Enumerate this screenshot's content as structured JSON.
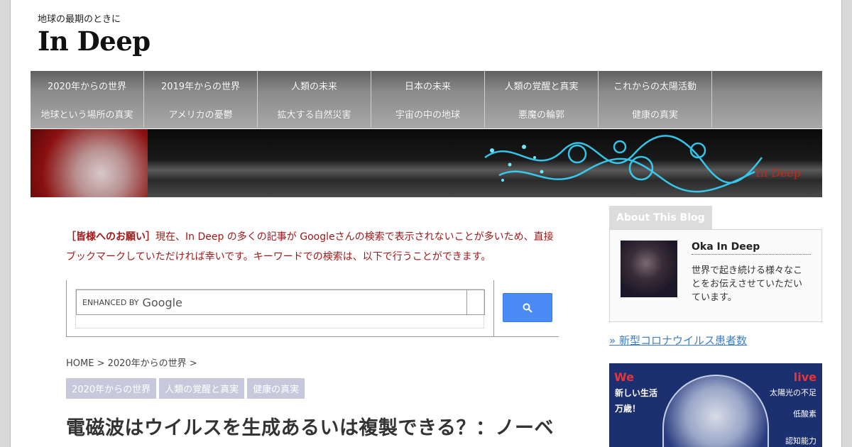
{
  "header": {
    "tagline": "地球の最期のときに",
    "logo": "In Deep"
  },
  "nav": {
    "row1": [
      "2020年からの世界",
      "2019年からの世界",
      "人類の未来",
      "日本の未来",
      "人類の覚醒と真実",
      "これからの太陽活動"
    ],
    "row2": [
      "地球という場所の真実",
      "アメリカの憂鬱",
      "拡大する自然災害",
      "宇宙の中の地球",
      "悪魔の輪郭",
      "健康の真実"
    ]
  },
  "banner": {
    "text": "In Deep"
  },
  "notice": {
    "label": "［皆様へのお願い］",
    "text": "現在、In Deep の多くの記事が Googleさんの検索で表示されないことが多いため、直接ブックマークしていただければ幸いです。キーワードでの検索は、以下で行うことができます。"
  },
  "search": {
    "enhanced_by": "ENHANCED BY",
    "google": "Google",
    "icon": "search-icon"
  },
  "breadcrumb": "HOME > 2020年からの世界 >",
  "tags": [
    "2020年からの世界",
    "人類の覚醒と真実",
    "健康の真実"
  ],
  "post": {
    "title": "電磁波はウイルスを生成あるいは複製できる？：ノーベ"
  },
  "sidebar": {
    "about_title": "About This Blog",
    "author": "Oka In Deep",
    "description": "世界で起き続ける様々なことをお伝えさせていただいています。",
    "link": "» 新型コロナウイルス患者数",
    "ad": {
      "we": "We",
      "live": "live",
      "left1": "新しい生活",
      "left2": "万歳！",
      "right1": "太陽光の不足",
      "right2": "低酸素",
      "right3": "認知能力"
    }
  }
}
